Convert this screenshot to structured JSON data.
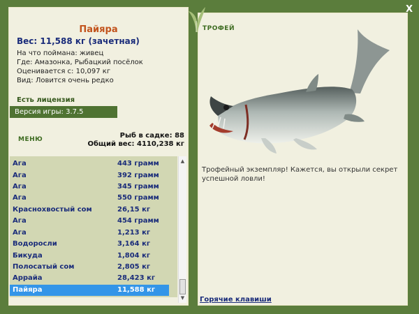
{
  "window": {
    "close_label": "X"
  },
  "fish": {
    "name": "Пайяра",
    "weight_line": "Вес: 11,588 кг (зачетная)",
    "details": [
      "На что поймана: живец",
      "Где: Амазонка, Рыбацкий посёлок",
      "Оценивается с: 10,097 кг",
      "Вид: Ловится очень редко"
    ]
  },
  "license": "Есть лицензия",
  "version": "Версия игры: 3.7.5",
  "menu_label": "МЕНЮ",
  "stats": {
    "fish_in_keepnet": "Рыб в садке: 88",
    "total_weight": "Общий вес: 4110,238 кг"
  },
  "fish_list": [
    {
      "name": "Ага",
      "weight": "443 грамм"
    },
    {
      "name": "Ага",
      "weight": "392 грамм"
    },
    {
      "name": "Ага",
      "weight": "345 грамм"
    },
    {
      "name": "Ага",
      "weight": "550 грамм"
    },
    {
      "name": "Краснохвостый сом",
      "weight": "26,15 кг"
    },
    {
      "name": "Ага",
      "weight": "454 грамм"
    },
    {
      "name": "Ага",
      "weight": "1,213 кг"
    },
    {
      "name": "Водоросли",
      "weight": "3,164 кг"
    },
    {
      "name": "Бикуда",
      "weight": "1,804 кг"
    },
    {
      "name": "Полосатый сом",
      "weight": "2,805 кг"
    },
    {
      "name": "Аррайа",
      "weight": "28,423 кг"
    },
    {
      "name": "Пайяра",
      "weight": "11,588 кг",
      "selected": true
    }
  ],
  "trophy": {
    "title": "ТРОФЕЙ",
    "text": "Трофейный экземпляр! Кажется, вы открыли секрет успешной ловли!"
  },
  "hotkeys_link": "Горячие клавиши",
  "icons": {
    "close": "close-icon",
    "leaf": "leaf-ornament-icon"
  },
  "colors": {
    "background": "#5b7d3c",
    "panel": "#f1f0e0",
    "list": "#d2d7b3",
    "selection": "#3395e8",
    "fish_name": "#c2531c"
  }
}
